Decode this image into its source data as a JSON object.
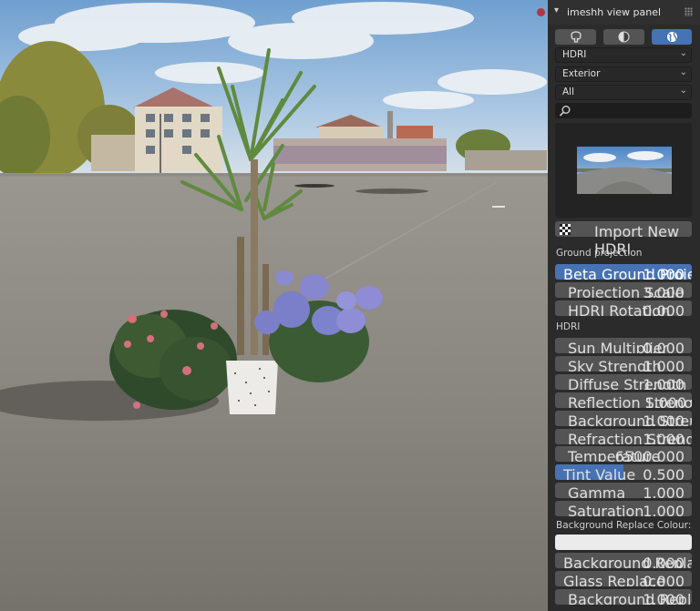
{
  "panel": {
    "title": "imeshh view panel",
    "collapse_icon": "chevron-down-icon",
    "grip_icon": "drag-grip-icon",
    "mode_buttons": [
      {
        "icon": "tree-icon",
        "active": false
      },
      {
        "icon": "material-sphere-icon",
        "active": false
      },
      {
        "icon": "world-icon",
        "active": true
      }
    ],
    "dropdowns": {
      "type": "HDRI",
      "category": "Exterior",
      "filter": "All"
    },
    "search_placeholder": "",
    "import_label": "Import New HDRI",
    "sections": {
      "ground": "Ground projection",
      "hdri": "HDRI",
      "bg_colour": "Background Replace Colour:"
    },
    "ground_fields": [
      {
        "label": "Beta Ground Projecti",
        "value": "1.000",
        "selected": true
      },
      {
        "label": "Projection Scale",
        "value": "3.000"
      },
      {
        "label": "HDRI Rotation",
        "value": "0.000"
      }
    ],
    "hdri_fields": [
      {
        "label": "Sun Multiplier",
        "value": "0.000"
      },
      {
        "label": "Sky Strength",
        "value": "1.000"
      },
      {
        "label": "Diffuse Strength",
        "value": "1.000"
      },
      {
        "label": "Reflection Strength",
        "value": "1.000"
      },
      {
        "label": "Background Streng",
        "value": "1.000"
      },
      {
        "label": "Refraction Strengt",
        "value": "1.000"
      },
      {
        "label": "Temperature",
        "value": "6500.000"
      },
      {
        "label": "Tint Value",
        "value": "0.500",
        "fill_fraction": 0.5
      },
      {
        "label": "Gamma",
        "value": "1.000"
      },
      {
        "label": "Saturation",
        "value": "1.000"
      }
    ],
    "bg_colour_value": "#ebebeb",
    "bottom_fields": [
      {
        "label": "Background Replace",
        "value": "0.000"
      },
      {
        "label": "Glass Replace",
        "value": "0.000"
      },
      {
        "label": "Background Repla",
        "value": "1.000"
      }
    ]
  },
  "colors": {
    "accent": "#4772b3",
    "panel_bg": "#2b2b2b",
    "field_bg": "#545454",
    "record_dot": "#b53444"
  }
}
